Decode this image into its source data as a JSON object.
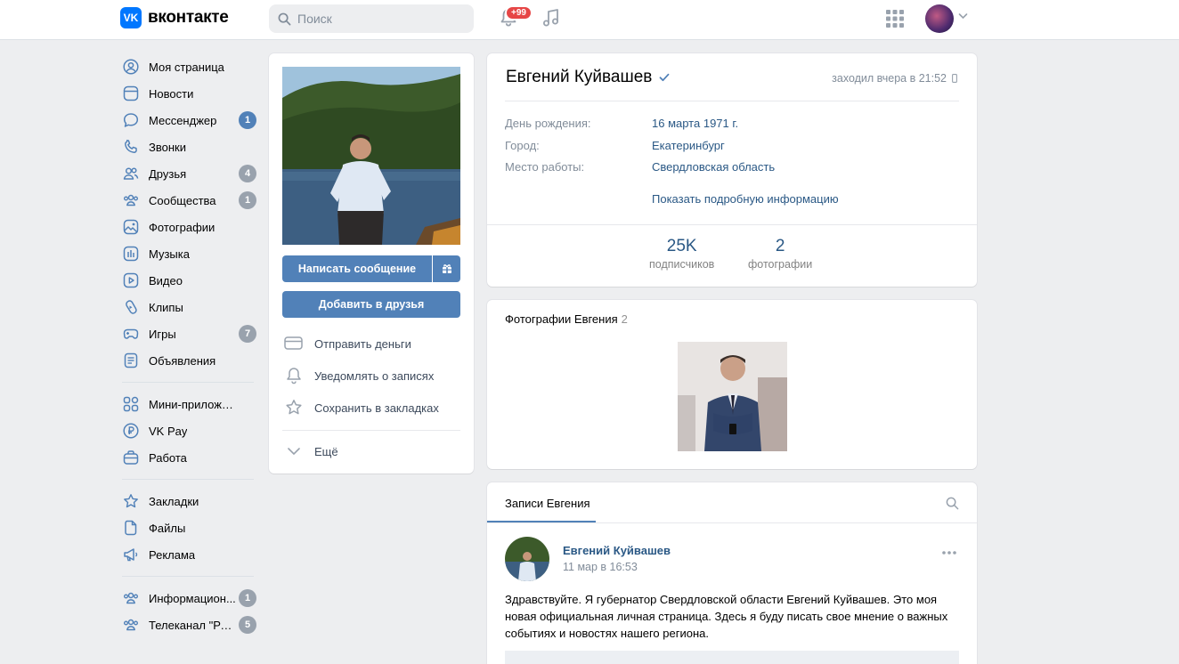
{
  "header": {
    "logo_text": "вконтакте",
    "search_placeholder": "Поиск",
    "notifications_badge": "+99"
  },
  "sidebar": {
    "items": [
      {
        "label": "Моя страница",
        "icon": "user-circle-icon",
        "count": ""
      },
      {
        "label": "Новости",
        "icon": "news-icon",
        "count": ""
      },
      {
        "label": "Мессенджер",
        "icon": "message-icon",
        "count": "1"
      },
      {
        "label": "Звонки",
        "icon": "phone-icon",
        "count": ""
      },
      {
        "label": "Друзья",
        "icon": "friends-icon",
        "count": "4"
      },
      {
        "label": "Сообщества",
        "icon": "communities-icon",
        "count": "1"
      },
      {
        "label": "Фотографии",
        "icon": "photo-icon",
        "count": ""
      },
      {
        "label": "Музыка",
        "icon": "music-icon",
        "count": ""
      },
      {
        "label": "Видео",
        "icon": "video-icon",
        "count": ""
      },
      {
        "label": "Клипы",
        "icon": "clips-icon",
        "count": ""
      },
      {
        "label": "Игры",
        "icon": "gamepad-icon",
        "count": "7"
      },
      {
        "label": "Объявления",
        "icon": "ads-icon",
        "count": ""
      }
    ],
    "items2": [
      {
        "label": "Мини-приложения",
        "icon": "apps-icon"
      },
      {
        "label": "VK Pay",
        "icon": "ruble-icon"
      },
      {
        "label": "Работа",
        "icon": "briefcase-icon"
      }
    ],
    "items3": [
      {
        "label": "Закладки",
        "icon": "star-icon"
      },
      {
        "label": "Файлы",
        "icon": "file-icon"
      },
      {
        "label": "Реклама",
        "icon": "megaphone-icon"
      }
    ],
    "items4": [
      {
        "label": "Информацион...",
        "icon": "group-icon",
        "count": "1"
      },
      {
        "label": "Телеканал \"Ре...",
        "icon": "group-icon",
        "count": "5"
      }
    ]
  },
  "profile": {
    "write_button": "Написать сообщение",
    "add_friend_button": "Добавить в друзья",
    "actions": {
      "send_money": "Отправить деньги",
      "notify": "Уведомлять о записях",
      "bookmark": "Сохранить в закладках",
      "more": "Ещё"
    }
  },
  "info": {
    "name": "Евгений Куйвашев",
    "last_seen": "заходил вчера в 21:52",
    "rows": [
      {
        "label": "День рождения:",
        "value": "16 марта 1971 г."
      },
      {
        "label": "Город:",
        "value": "Екатеринбург"
      },
      {
        "label": "Место работы:",
        "value": "Свердловская область"
      }
    ],
    "show_more": "Показать подробную информацию",
    "stats": [
      {
        "num": "25K",
        "cap": "подписчиков"
      },
      {
        "num": "2",
        "cap": "фотографии"
      }
    ]
  },
  "photos": {
    "title": "Фотографии Евгения",
    "count": "2"
  },
  "wall": {
    "tab": "Записи Евгения",
    "post": {
      "author": "Евгений Куйвашев",
      "date": "11 мар в 16:53",
      "text": "Здравствуйте. Я губернатор Свердловской области Евгений Куйвашев. Это моя новая официальная личная страница. Здесь я буду писать свое мнение о важных событиях и новостях нашего региона."
    }
  },
  "colors": {
    "accent": "#5181b8",
    "link": "#2a5885",
    "background": "#edeef0",
    "badge_red": "#e64646"
  }
}
